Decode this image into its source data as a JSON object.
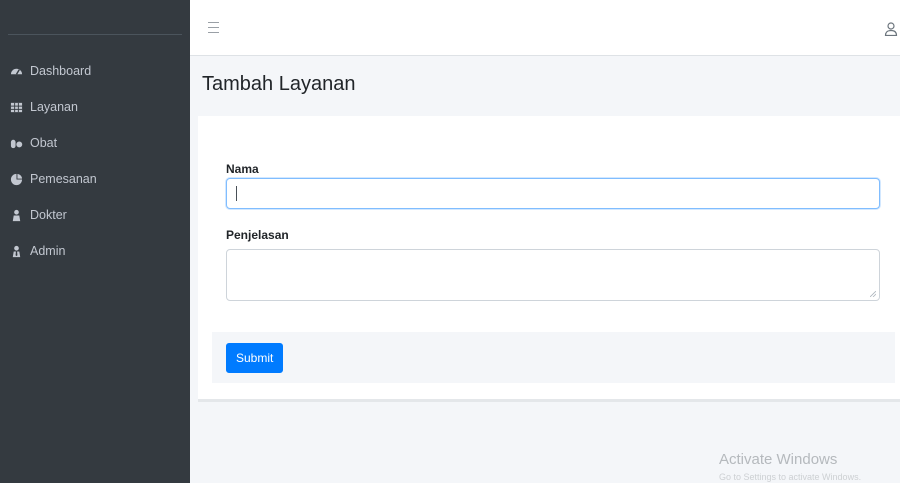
{
  "sidebar": {
    "items": [
      {
        "label": "Dashboard",
        "icon": "tachometer-icon"
      },
      {
        "label": "Layanan",
        "icon": "table-icon"
      },
      {
        "label": "Obat",
        "icon": "pills-icon"
      },
      {
        "label": "Pemesanan",
        "icon": "pie-chart-icon"
      },
      {
        "label": "Dokter",
        "icon": "user-md-icon"
      },
      {
        "label": "Admin",
        "icon": "user-tie-icon"
      }
    ]
  },
  "topbar": {
    "menu_icon": "hamburger-icon",
    "user_icon": "user-icon"
  },
  "page": {
    "title": "Tambah Layanan"
  },
  "form": {
    "nama_label": "Nama",
    "nama_value": "",
    "penjelasan_label": "Penjelasan",
    "penjelasan_value": "",
    "submit_label": "Submit"
  },
  "watermark": {
    "title": "Activate Windows",
    "subtitle": "Go to Settings to activate Windows."
  },
  "colors": {
    "sidebar_bg": "#343a40",
    "sidebar_text": "#c2c7d0",
    "primary": "#007bff",
    "content_bg": "#f4f6f9",
    "focus_border": "#80bdff"
  }
}
